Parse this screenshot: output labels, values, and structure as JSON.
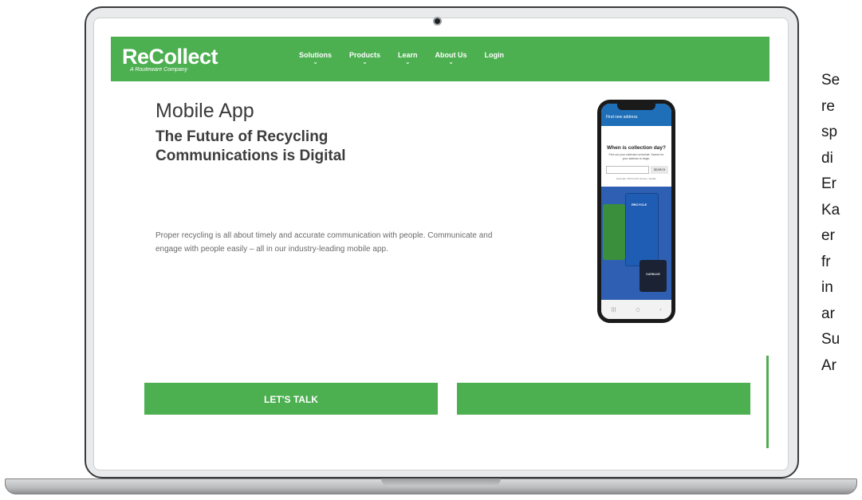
{
  "site": {
    "logo_text": "ReCollect",
    "logo_tagline": "A Routeware Company",
    "nav": [
      {
        "label": "Solutions",
        "has_dropdown": true
      },
      {
        "label": "Products",
        "has_dropdown": true
      },
      {
        "label": "Learn",
        "has_dropdown": true
      },
      {
        "label": "About Us",
        "has_dropdown": true
      },
      {
        "label": "Login",
        "has_dropdown": false
      }
    ]
  },
  "hero": {
    "title": "Mobile App",
    "subtitle": "The Future of Recycling Communications is Digital",
    "body": "Proper recycling is all about timely and accurate communication with people. Communicate and engage with people easily – all in our industry-leading mobile app."
  },
  "phone": {
    "header": "Find new address",
    "question": "When is collection day?",
    "hint": "Find out your collection schedule. Search for your address to begin.",
    "search_button": "SEARCH",
    "example": "Example: 400 Fourth Avenue, Seattle",
    "bin_label": "RECYCLE",
    "bin_label_2": "GARBAGE"
  },
  "cta": {
    "left_label": "LET'S TALK",
    "right_label": ""
  },
  "side_text": [
    "Se",
    "re",
    "sp",
    "di",
    "Er",
    "Ka",
    "er",
    "fr",
    "in",
    "ar",
    "Su",
    "Ar"
  ],
  "colors": {
    "brand_green": "#4caf50",
    "phone_blue": "#1e6fb8"
  }
}
